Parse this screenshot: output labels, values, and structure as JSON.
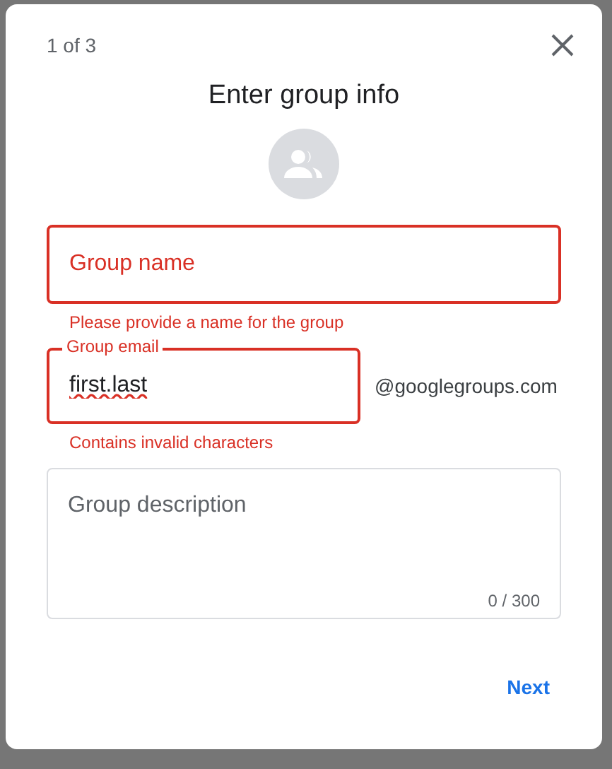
{
  "dialog": {
    "step": "1 of 3",
    "title": "Enter group info",
    "fields": [
      {
        "kind": "input",
        "placeholder": "Group name",
        "invalid": true,
        "error": "Please provide a name for the group"
      },
      {
        "kind": "input",
        "label": "Group email",
        "value": "first.last",
        "misspelled": true,
        "suffix": "@googlegroups.com",
        "invalid": true,
        "error": "Contains invalid characters"
      },
      {
        "kind": "textarea",
        "placeholder": "Group description",
        "invalid": false,
        "counter": "0 / 300"
      }
    ],
    "buttons": [
      {
        "label": "Next"
      }
    ]
  }
}
